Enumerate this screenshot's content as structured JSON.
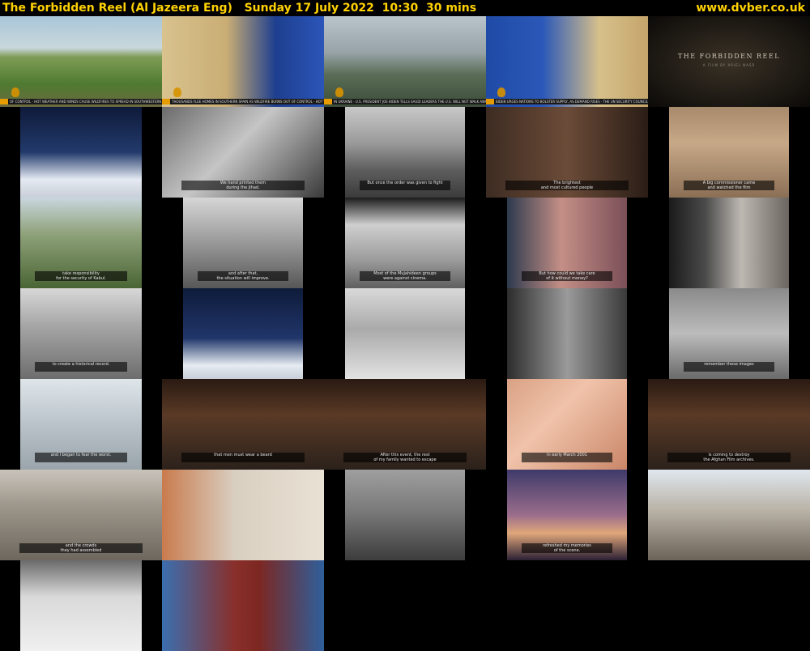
{
  "header": {
    "programme": "The Forbidden Reel (Al Jazeera Eng)",
    "date": "Sunday 17 July 2022",
    "time": "10:30",
    "duration": "30 mins",
    "site": "www.dvber.co.uk"
  },
  "title_card": {
    "title": "THE FORBIDDEN REEL",
    "subtitle": "A FILM BY ARIEL NASR"
  },
  "rows": [
    [
      {
        "scene": "farm field with workers",
        "bg": "linear-gradient(#a9c6d8 0%,#c9d7dd 35%,#7f9c55 45%,#4f7a31 75%,#6c6a3f 100%)",
        "ticker": "OF CONTROL · HOT WEATHER AND WINDS CAUSE WILDFIRES TO SPREAD IN SOUTHWESTERN FRANCE"
      },
      {
        "scene": "presenter with map",
        "bg": "linear-gradient(90deg,#d8c28e 0%,#c9ad74 40%,#1e3f8f 70%,#2b55b8 100%)",
        "ticker": "THOUSANDS FLEE HOMES IN SOUTHERN SPAIN AS WILDFIRE BURNS OUT OF CONTROL · HOT WEATHER"
      },
      {
        "scene": "man reporting in city",
        "bg": "linear-gradient(#b9c4cc 0%,#98a3a7 40%,#596c55 65%,#3c4e39 100%)",
        "ticker": "IN UKRAINE · U.S. PRESIDENT JOE BIDEN TELLS SAUDI LEADERS THE U.S. WILL NOT WALK AWAY FROM"
      },
      {
        "scene": "presenter with map",
        "bg": "linear-gradient(90deg,#1f4aa6 0%,#2b58b8 35%,#d7c08b 70%,#c4a56b 100%)",
        "ticker": "BIDEN URGES NATIONS TO BOLSTER SUPPLY, AS DEMAND RISES · THE UN SECURITY COUNCIL"
      },
      {
        "scene": "title card",
        "bg": "radial-gradient(ellipse at center,#3a3226 0%,#1a1611 70%,#0b0a08 100%)"
      }
    ],
    [
      {
        "scene": "",
        "bg": "linear-gradient(#0f1a3a 0%,#223a6b 50%,#e4e9f2 80%,#c9cfd8 100%)"
      },
      {
        "scene": "",
        "bg": "linear-gradient(135deg,#6b6b6b,#c5c5c5 45%,#3a3a3a 100%)",
        "sub": "We hand printed them\nduring the Jihad."
      },
      {
        "scene": "",
        "bg": "linear-gradient(#c8c8c8 0%,#9a9a9a 40%,#5d5d5d 70%,#3b3b3b 100%)",
        "sub": "But once the order was given to fight"
      },
      {
        "scene": "",
        "bg": "linear-gradient(90deg,#3d2c22,#6b4b38 50%,#2a1d16)",
        "sub": "The brightest\nand most cultured people"
      },
      {
        "scene": "",
        "bg": "linear-gradient(#a88a6c 0%,#c7a887 40%,#8b6f55 100%)",
        "sub": "A big commissioner came\nand watched the film"
      }
    ],
    [
      {
        "scene": "",
        "bg": "linear-gradient(#c9d6de 0%,#8fa27a 40%,#4a6534 100%)",
        "sub": "take responsibility\nfor the security of Kabul."
      },
      {
        "scene": "",
        "bg": "linear-gradient(#d6d6d6 0%,#9f9f9f 45%,#575757 100%)",
        "sub": "and after that,\nthe situation will improve."
      },
      {
        "scene": "",
        "bg": "linear-gradient(#1b1b1b 0%,#cfcfcf 30%,#9a9a9a 70%,#5f5f5f 100%)",
        "sub": "Most of the Mujahideen groups\nwere against cinema."
      },
      {
        "scene": "",
        "bg": "linear-gradient(90deg,#2d3a4e,#c48f86 45%,#7a4f58 100%)",
        "sub": "But how could we take care\nof it without money?"
      },
      {
        "scene": "",
        "bg": "linear-gradient(90deg,#1a1a1a 0%,#4a4a4a 30%,#bdb8b2 60%,#6b6560 100%)"
      }
    ],
    [
      {
        "scene": "",
        "bg": "linear-gradient(#d8d8d8 0%,#a7a7a7 40%,#6d6d6d 100%)",
        "sub": "to create a historical record."
      },
      {
        "scene": "",
        "bg": "linear-gradient(#0e1b3a 0%,#20366a 55%,#e6ebf2 85%,#c8cfd9 100%)"
      },
      {
        "scene": "",
        "bg": "linear-gradient(#d9d9d9 0%,#aaaaaa 45%,#e2e2e2 100%)"
      },
      {
        "scene": "",
        "bg": "linear-gradient(90deg,#2c2c2c,#9a9a9a 50%,#3a3a3a)"
      },
      {
        "scene": "",
        "bg": "linear-gradient(#8a8a8a 0%,#bcbcbc 50%,#6a6a6a 100%)",
        "sub": "remember these images"
      }
    ],
    [
      {
        "scene": "",
        "bg": "linear-gradient(#dfe6ea 0%,#b9c3c9 50%,#9aa5ab 100%)",
        "sub": "and I began to fear the worst."
      },
      {
        "scene": "",
        "bg": "linear-gradient(#2a1a12 0%,#5a3a26 40%,#2b211b 100%)",
        "sub": "that men must wear a beard"
      },
      {
        "scene": "",
        "bg": "linear-gradient(#2a1a12 0%,#5a3a26 40%,#2b211b 100%)",
        "sub": "After this event, the rest\nof my family wanted to escape"
      },
      {
        "scene": "",
        "bg": "linear-gradient(135deg,#d9a184,#f0c3aa 40%,#c98668 100%)",
        "sub": "In early March 2001"
      },
      {
        "scene": "",
        "bg": "linear-gradient(#2a1a12 0%,#5a3a26 40%,#2b211b 100%)",
        "sub": "is coming to destroy\nthe Afghan Film archives."
      }
    ],
    [
      {
        "scene": "",
        "bg": "linear-gradient(#c9c4bb 0%,#9d968b 40%,#6d675e 100%)",
        "sub": "and the crowds\nthey had assembled"
      },
      {
        "scene": "",
        "bg": "linear-gradient(90deg,#c97b4d,#d9cfc1 45%,#e9e1d4 100%)"
      },
      {
        "scene": "",
        "bg": "linear-gradient(#9f9f9f 0%,#7a7a7a 45%,#3d3d3d 100%)"
      },
      {
        "scene": "",
        "bg": "linear-gradient(#3e3a6a 0%,#9a6d8b 50%,#e0a77a 70%,#2b2034 100%)",
        "sub": "refreshed my memories\nof the scene."
      },
      {
        "scene": "",
        "bg": "linear-gradient(#dfe7ee 0%,#b9b2a6 45%,#6b6358 100%)"
      }
    ],
    [
      {
        "scene": "",
        "bg": "linear-gradient(#6b6b6b 0%,#d9d9d9 40%,#f0f0f0 100%)"
      },
      {
        "scene": "",
        "bg": "linear-gradient(90deg,#3b6fb0,#8a2f2a 45%,#7c2722 60%,#2f5f9b 100%)"
      }
    ]
  ]
}
